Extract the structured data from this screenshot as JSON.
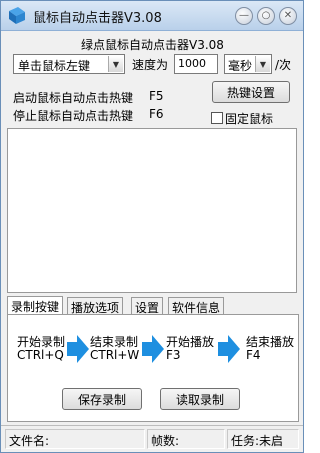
{
  "window": {
    "title": "鼠标自动点击器V3.08",
    "controls": {
      "minimize_icon": "minimize-icon",
      "maximize_icon": "maximize-icon",
      "close_icon": "close-icon"
    }
  },
  "heading": "绿点鼠标自动点击器V3.08",
  "settings": {
    "click_mode": "单击鼠标左键",
    "speed_label": "速度为",
    "speed_value": "1000",
    "unit": "毫秒",
    "per_label": "/次"
  },
  "hotkeys": {
    "start_label": "启动鼠标自动点击热键",
    "start_key": "F5",
    "stop_label": "停止鼠标自动点击热键",
    "stop_key": "F6",
    "settings_button": "热键设置",
    "fix_mouse_label": "固定鼠标",
    "fix_mouse_checked": false
  },
  "tabs": [
    "录制按键",
    "播放选项",
    "设置",
    "软件信息"
  ],
  "record_panel": {
    "steps": [
      {
        "title": "开始录制",
        "key": "CTRl+Q"
      },
      {
        "title": "结束录制",
        "key": "CTRl+W"
      },
      {
        "title": "开始播放",
        "key": "F3"
      },
      {
        "title": "结束播放",
        "key": "F4"
      }
    ],
    "save_button": "保存录制",
    "load_button": "读取录制",
    "arrow_color": "#1e8fe0"
  },
  "status": {
    "filename_label": "文件名:",
    "frames_label": "帧数:",
    "task_label": "任务:未启"
  }
}
